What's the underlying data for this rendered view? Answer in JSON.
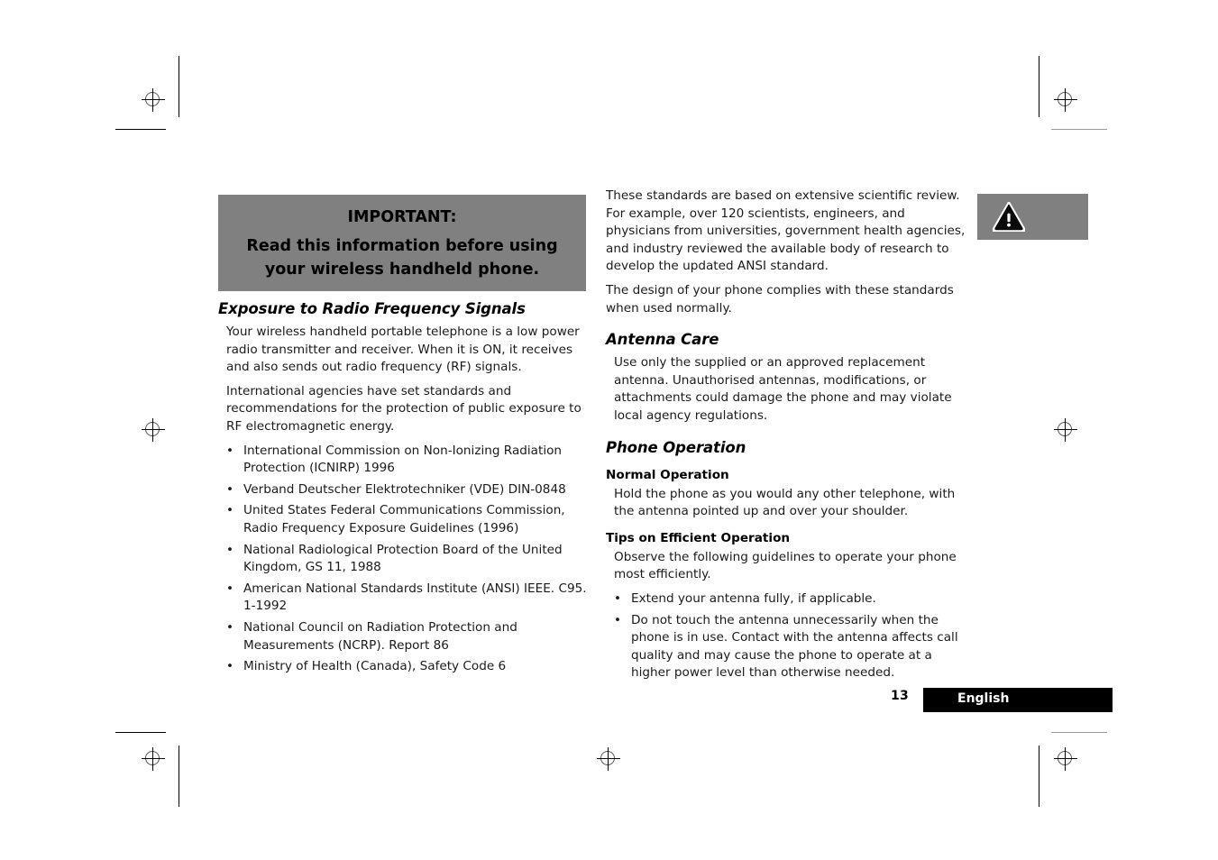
{
  "document": {
    "page_number": "13",
    "footer_language": "English",
    "colors": {
      "callout_gray": "#808080",
      "footer_bar": "#000000",
      "body_text": "#1a1a1a"
    }
  },
  "important_callout": {
    "line1": "IMPORTANT:",
    "line2": "Read this information before using",
    "line3": "your wireless handheld phone."
  },
  "warning_callout": {
    "icon": "warning-triangle-icon"
  },
  "left_column": {
    "heading": "Exposure to Radio Frequency Signals",
    "paragraphs": [
      "Your wireless handheld portable telephone is a low power radio transmitter and receiver. When it is ON, it receives and also sends out radio frequency (RF) signals.",
      "International agencies have set standards and recommendations for the protection of public exposure to RF electromagnetic energy."
    ],
    "bullet_marker": "•",
    "bullets": [
      "International Commission on Non-Ionizing Radiation Protection (ICNIRP) 1996",
      "Verband Deutscher Elektrotechniker (VDE) DIN-0848",
      "United States Federal Communications Commission, Radio Frequency Exposure Guidelines (1996)",
      "National Radiological Protection Board of the United Kingdom, GS 11, 1988",
      "American National Standards Institute (ANSI) IEEE. C95. 1-1992",
      "National Council on Radiation Protection and Measurements (NCRP). Report 86",
      "Ministry of Health (Canada), Safety Code 6"
    ]
  },
  "right_column": {
    "intro_paragraphs": [
      "These standards are based on extensive scientific review. For example, over 120 scientists, engineers, and physicians from universities, government health agencies, and industry reviewed the available body of research to develop the updated ANSI standard.",
      "The design of your phone complies with these standards when used normally."
    ],
    "antenna_care": {
      "heading": "Antenna Care",
      "paragraph": "Use only the supplied or an approved replacement antenna. Unauthorised antennas, modifications, or attachments could damage the phone and may violate local agency regulations."
    },
    "phone_operation": {
      "heading": "Phone Operation",
      "normal_operation": {
        "heading": "Normal Operation",
        "paragraph": "Hold the phone as you would any other telephone, with the antenna pointed up and over your shoulder."
      },
      "tips": {
        "heading": "Tips on Efficient Operation",
        "paragraph": "Observe the following guidelines to operate your phone most efficiently.",
        "bullet_marker": "•",
        "bullets": [
          "Extend your antenna fully, if applicable.",
          "Do not touch the antenna unnecessarily when the phone is in use. Contact with the antenna affects call quality and may cause the phone to operate at a higher power level than otherwise needed."
        ]
      }
    }
  }
}
